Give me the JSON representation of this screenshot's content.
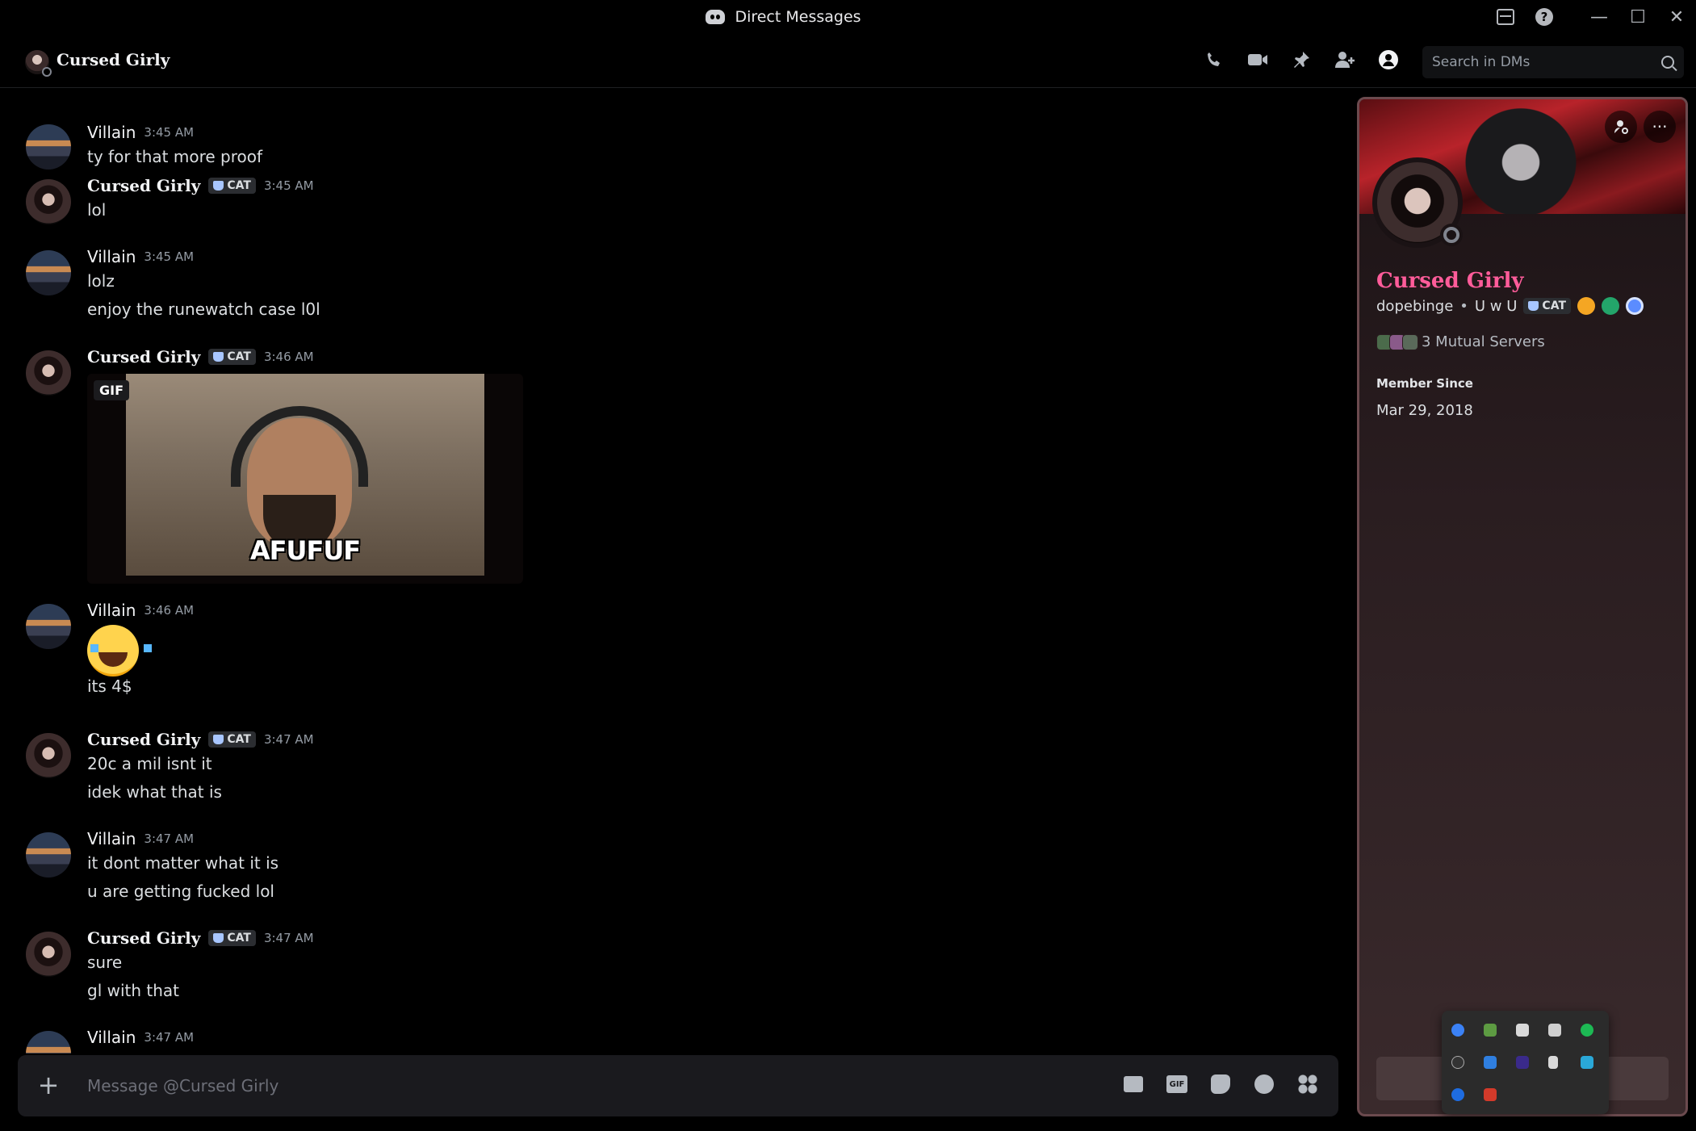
{
  "window": {
    "title": "Direct Messages",
    "controls": {
      "minimize": "—",
      "maximize": "☐",
      "close": "✕"
    }
  },
  "header": {
    "name": "Cursed Girly",
    "search_placeholder": "Search in DMs",
    "icons": [
      "phone-call-icon",
      "video-call-icon",
      "pin-icon",
      "add-friend-icon",
      "user-profile-icon"
    ]
  },
  "messages": [
    {
      "author": "Villain",
      "time": "3:45 AM",
      "lines": [
        "ty for that more proof"
      ]
    },
    {
      "author": "Cursed Girly",
      "tag": "CAT",
      "time": "3:45 AM",
      "lines": [
        "lol"
      ]
    },
    {
      "author": "Villain",
      "time": "3:45 AM",
      "lines": [
        "lolz",
        "enjoy the runewatch case l0l"
      ]
    },
    {
      "author": "Cursed Girly",
      "tag": "CAT",
      "time": "3:46 AM",
      "gif": {
        "badge": "GIF",
        "caption": "AFUFUF"
      }
    },
    {
      "author": "Villain",
      "time": "3:46 AM",
      "emoji": "joy",
      "lines": [
        "its 4$"
      ]
    },
    {
      "author": "Cursed Girly",
      "tag": "CAT",
      "time": "3:47 AM",
      "lines": [
        "20c a mil isnt it",
        "idek what that is"
      ]
    },
    {
      "author": "Villain",
      "time": "3:47 AM",
      "lines": [
        "it dont matter what it is",
        "u are getting fucked lol"
      ]
    },
    {
      "author": "Cursed Girly",
      "tag": "CAT",
      "time": "3:47 AM",
      "lines": [
        "sure",
        "gl with that"
      ]
    },
    {
      "author": "Villain",
      "time": "3:47 AM",
      "lines": []
    }
  ],
  "composer": {
    "placeholder": "Message @Cursed Girly",
    "plus": "+",
    "gif_label": "GIF"
  },
  "profile": {
    "display_name": "Cursed Girly",
    "username": "dopebinge",
    "pronouns": "U w U",
    "tag": "CAT",
    "mutual_servers": "3 Mutual Servers",
    "member_since_label": "Member Since",
    "member_since_value": "Mar 29, 2018",
    "more": "···",
    "colors": {
      "name": "#ff5c9a",
      "border": "#6b4a4e"
    }
  }
}
